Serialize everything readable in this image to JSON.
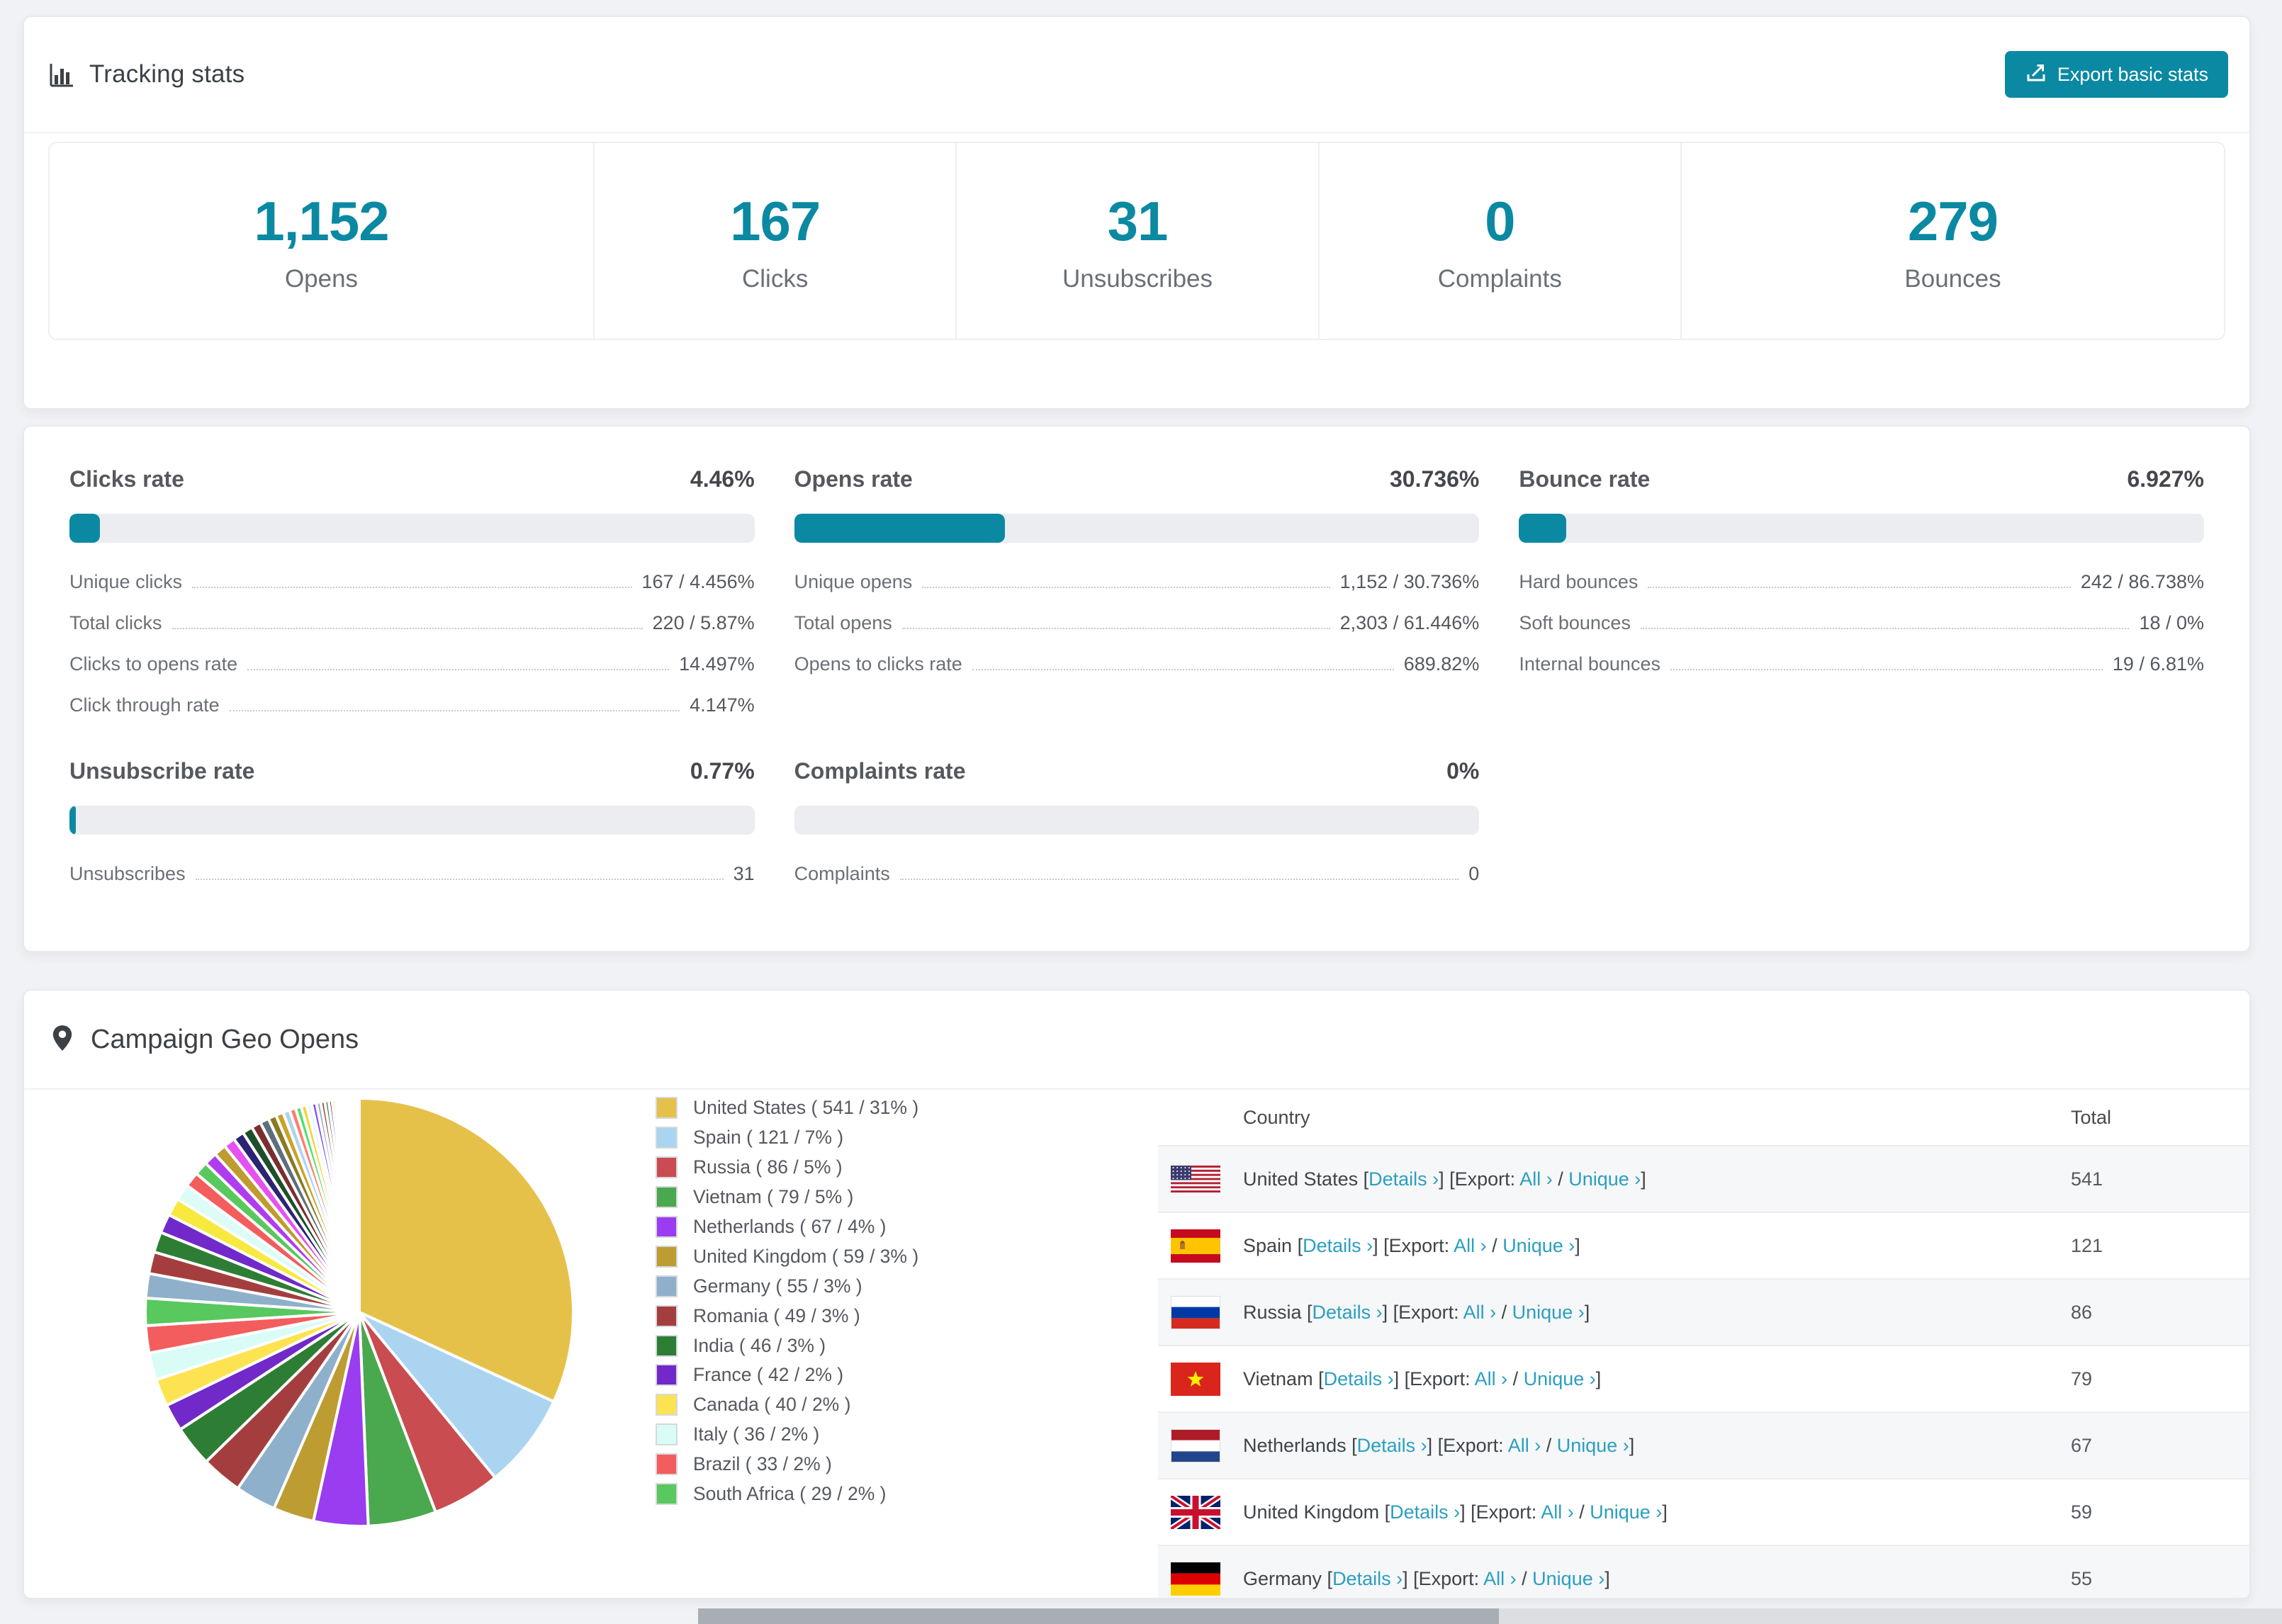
{
  "colors": {
    "accent": "#0b89a2",
    "link": "#2b9fc0"
  },
  "tracking": {
    "title": "Tracking stats",
    "export_label": "Export basic stats"
  },
  "stats": [
    {
      "value": "1,152",
      "label": "Opens"
    },
    {
      "value": "167",
      "label": "Clicks"
    },
    {
      "value": "31",
      "label": "Unsubscribes"
    },
    {
      "value": "0",
      "label": "Complaints"
    },
    {
      "value": "279",
      "label": "Bounces"
    }
  ],
  "rates": [
    {
      "title": "Clicks rate",
      "value": "4.46%",
      "percent": 4.46,
      "rows": [
        {
          "label": "Unique clicks",
          "value": "167 / 4.456%"
        },
        {
          "label": "Total clicks",
          "value": "220 / 5.87%"
        },
        {
          "label": "Clicks to opens rate",
          "value": "14.497%"
        },
        {
          "label": "Click through rate",
          "value": "4.147%"
        }
      ]
    },
    {
      "title": "Opens rate",
      "value": "30.736%",
      "percent": 30.736,
      "rows": [
        {
          "label": "Unique opens",
          "value": "1,152 / 30.736%"
        },
        {
          "label": "Total opens",
          "value": "2,303 / 61.446%"
        },
        {
          "label": "Opens to clicks rate",
          "value": "689.82%"
        }
      ]
    },
    {
      "title": "Bounce rate",
      "value": "6.927%",
      "percent": 6.927,
      "rows": [
        {
          "label": "Hard bounces",
          "value": "242 / 86.738%"
        },
        {
          "label": "Soft bounces",
          "value": "18 / 0%"
        },
        {
          "label": "Internal bounces",
          "value": "19 / 6.81%"
        }
      ]
    },
    {
      "title": "Unsubscribe rate",
      "value": "0.77%",
      "percent": 0.77,
      "rows": [
        {
          "label": "Unsubscribes",
          "value": "31"
        }
      ]
    },
    {
      "title": "Complaints rate",
      "value": "0%",
      "percent": 0,
      "rows": [
        {
          "label": "Complaints",
          "value": "0"
        }
      ]
    }
  ],
  "geo": {
    "title": "Campaign Geo Opens",
    "table": {
      "country_header": "Country",
      "total_header": "Total",
      "link_details": "Details ›",
      "export_text": "Export:",
      "link_all": "All ›",
      "link_unique": "Unique ›",
      "rows": [
        {
          "country": "United States",
          "flag": "us",
          "total": "541"
        },
        {
          "country": "Spain",
          "flag": "es",
          "total": "121"
        },
        {
          "country": "Russia",
          "flag": "ru",
          "total": "86"
        },
        {
          "country": "Vietnam",
          "flag": "vn",
          "total": "79"
        },
        {
          "country": "Netherlands",
          "flag": "nl",
          "total": "67"
        },
        {
          "country": "United Kingdom",
          "flag": "gb",
          "total": "59"
        },
        {
          "country": "Germany",
          "flag": "de",
          "total": "55"
        }
      ]
    }
  },
  "chart_data": {
    "type": "pie",
    "title": "Campaign Geo Opens",
    "legend_position": "right",
    "start_angle_deg": -90,
    "direction": "clockwise",
    "slices": [
      {
        "name": "United States",
        "count": 541,
        "pct": 31,
        "color": "#e6c14a",
        "legend": "United States ( 541 / 31% )"
      },
      {
        "name": "Spain",
        "count": 121,
        "pct": 7,
        "color": "#abd4f1",
        "legend": "Spain ( 121 / 7% )"
      },
      {
        "name": "Russia",
        "count": 86,
        "pct": 5,
        "color": "#c94c50",
        "legend": "Russia ( 86 / 5% )"
      },
      {
        "name": "Vietnam",
        "count": 79,
        "pct": 5,
        "color": "#4aa84e",
        "legend": "Vietnam ( 79 / 5% )"
      },
      {
        "name": "Netherlands",
        "count": 67,
        "pct": 4,
        "color": "#9a3cf0",
        "legend": "Netherlands ( 67 / 4% )"
      },
      {
        "name": "United Kingdom",
        "count": 59,
        "pct": 3,
        "color": "#bd9c31",
        "legend": "United Kingdom ( 59 / 3% )"
      },
      {
        "name": "Germany",
        "count": 55,
        "pct": 3,
        "color": "#8fb0ca",
        "legend": "Germany ( 55 / 3% )"
      },
      {
        "name": "Romania",
        "count": 49,
        "pct": 3,
        "color": "#a43e3e",
        "legend": "Romania ( 49 / 3% )"
      },
      {
        "name": "India",
        "count": 46,
        "pct": 3,
        "color": "#2e7d35",
        "legend": "India ( 46 / 3% )"
      },
      {
        "name": "France",
        "count": 42,
        "pct": 2,
        "color": "#7129c9",
        "legend": "France ( 42 / 2% )"
      },
      {
        "name": "Canada",
        "count": 40,
        "pct": 2,
        "color": "#fde351",
        "legend": "Canada ( 40 / 2% )"
      },
      {
        "name": "Italy",
        "count": 36,
        "pct": 2,
        "color": "#d9fcf7",
        "legend": "Italy ( 36 / 2% )"
      },
      {
        "name": "Brazil",
        "count": 33,
        "pct": 2,
        "color": "#f35d5d",
        "legend": "Brazil ( 33 / 2% )"
      },
      {
        "name": "South Africa",
        "count": 29,
        "pct": 2,
        "color": "#58c85f",
        "legend": "South Africa ( 29 / 2% )"
      }
    ],
    "other_slices": {
      "note": "many small unlabeled countries, drawn clockwise with decreasing size",
      "values": [
        1.8,
        1.6,
        1.5,
        1.4,
        1.3,
        1.2,
        1.1,
        1.0,
        0.95,
        0.9,
        0.85,
        0.8,
        0.75,
        0.7,
        0.65,
        0.6,
        0.55,
        0.5,
        0.46,
        0.42,
        0.4,
        0.38,
        0.35,
        0.32,
        0.3,
        0.28,
        0.26,
        0.24,
        0.22,
        0.2,
        0.18,
        0.16,
        0.14,
        0.12,
        0.11,
        0.1,
        0.09,
        0.08,
        0.07,
        0.06,
        0.05,
        0.04,
        0.04,
        0.03,
        0.03,
        0.02
      ],
      "palette": [
        "#8fb0ca",
        "#a43e3e",
        "#2e7d35",
        "#7129c9",
        "#f7e93f",
        "#ddfcf8",
        "#f35d5d",
        "#58c85f",
        "#b03cf0",
        "#bd9c31",
        "#e552f0",
        "#2b2472",
        "#1e4f2b",
        "#7a2e2e",
        "#5d6e7c",
        "#8a7a22",
        "#c9a227",
        "#abd3f0",
        "#ff7d6b",
        "#52e06a",
        "#f2d43d",
        "#e8f7fd",
        "#8a52f2"
      ]
    }
  }
}
